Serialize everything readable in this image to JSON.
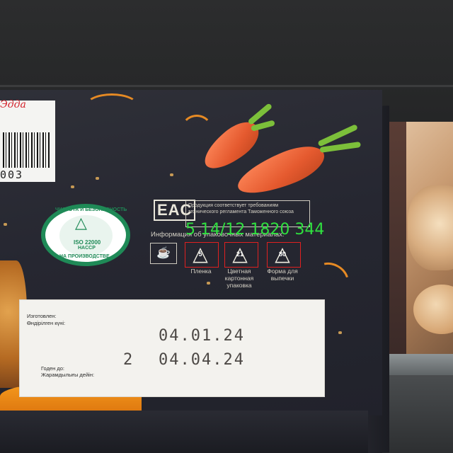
{
  "barcode": {
    "number": "003"
  },
  "brand": {
    "logo_text": "Эдда"
  },
  "seal": {
    "top_text": "ЧИСТОТА И БЕЗОПАСНОСТЬ",
    "iso": "ISO 22000",
    "haccp": "HACCP",
    "bottom_text": "НА ПРОИЗВОДСТВЕ",
    "icon": "hand-drop-icon"
  },
  "certification": {
    "mark": "EAC",
    "statement": "Продукция соответствует требованиям технического регламента Таможенного союза",
    "packaging_info": "Информация об упаковочных материалах:"
  },
  "recycling": [
    {
      "code": "5",
      "label": "Пленка"
    },
    {
      "code": "21",
      "label": "Цветная картонная упаковка"
    },
    {
      "code": "80",
      "label": "Форма для выпечки"
    }
  ],
  "ocr_overlay": {
    "text": "5 14/12 1820 344",
    "color": "#2fe03f"
  },
  "date_label": {
    "manufactured_ru": "Изготовлен:",
    "manufactured_kz": "Өндірілген күні:",
    "manufactured_date": "04.01.24",
    "best_before_ru": "Годен до:",
    "best_before_kz": "Жарамдылығы дейін:",
    "best_before_date": "04.04.24",
    "shift_number": "2"
  },
  "colors": {
    "box": "#262731",
    "seal_green": "#1f8a57",
    "carrot": "#e55a2f",
    "label": "#f3f2ee"
  }
}
